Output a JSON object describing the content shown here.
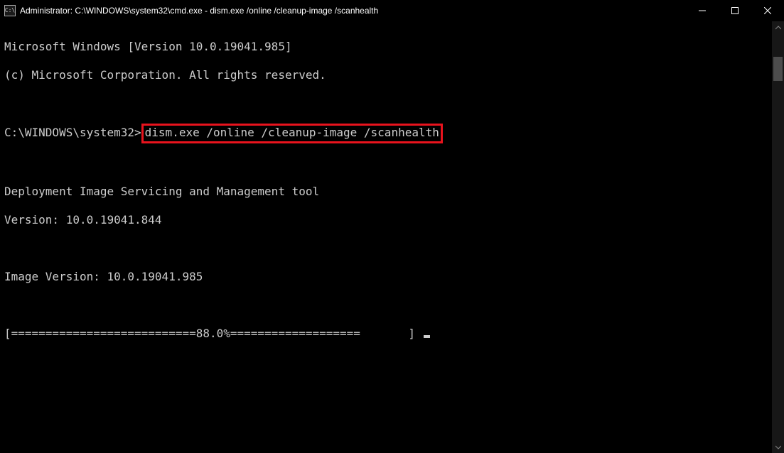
{
  "titlebar": {
    "icon_label": "C:\\",
    "title": "Administrator: C:\\WINDOWS\\system32\\cmd.exe - dism.exe  /online /cleanup-image /scanhealth"
  },
  "window_controls": {
    "minimize": "Minimize",
    "maximize": "Maximize",
    "close": "Close"
  },
  "terminal": {
    "line1": "Microsoft Windows [Version 10.0.19041.985]",
    "line2": "(c) Microsoft Corporation. All rights reserved.",
    "blank": "",
    "prompt_prefix": "C:\\WINDOWS\\system32>",
    "command": "dism.exe /online /cleanup-image /scanhealth",
    "line_tool": "Deployment Image Servicing and Management tool",
    "line_version": "Version: 10.0.19041.844",
    "line_image_version": "Image Version: 10.0.19041.985",
    "progress_line": "[===========================88.0%===================       ] "
  },
  "highlight": {
    "color": "#e8131d"
  }
}
